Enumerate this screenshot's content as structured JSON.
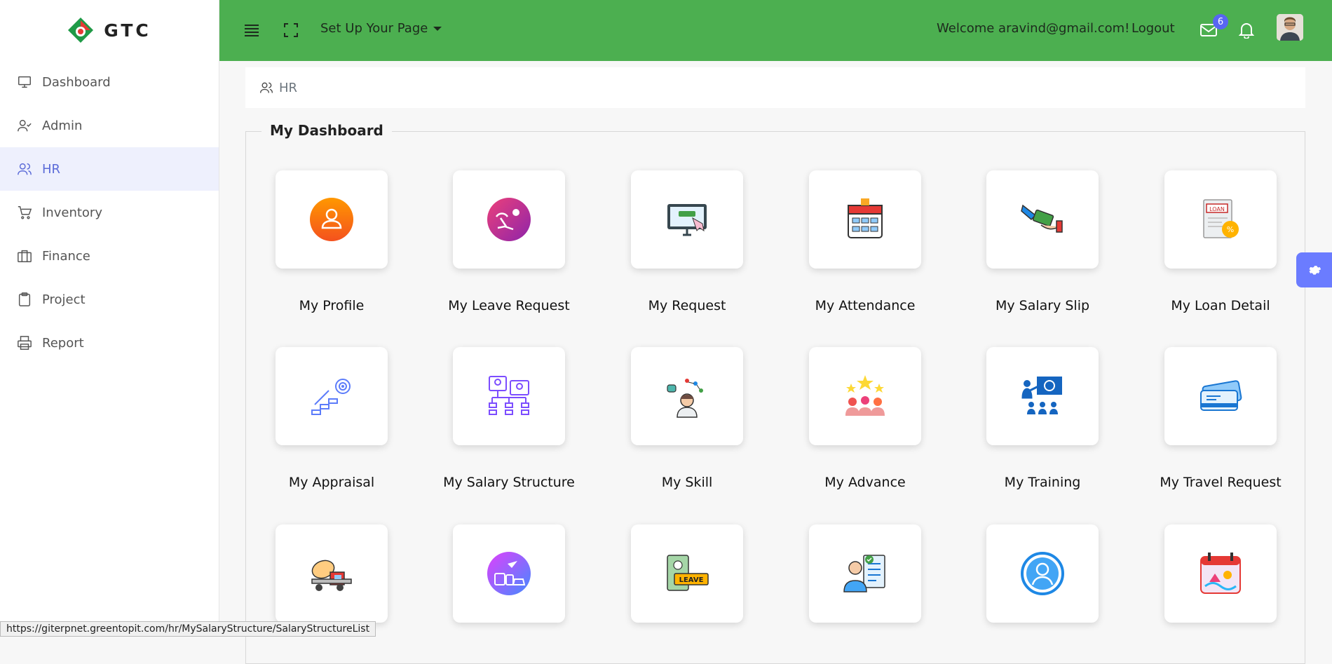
{
  "brand": {
    "name": "GTC"
  },
  "sidebar": {
    "items": [
      {
        "label": "Dashboard",
        "icon": "monitor-icon"
      },
      {
        "label": "Admin",
        "icon": "user-check-icon"
      },
      {
        "label": "HR",
        "icon": "users-icon",
        "active": true
      },
      {
        "label": "Inventory",
        "icon": "cart-icon"
      },
      {
        "label": "Finance",
        "icon": "briefcase-icon"
      },
      {
        "label": "Project",
        "icon": "clipboard-icon"
      },
      {
        "label": "Report",
        "icon": "printer-icon"
      }
    ]
  },
  "header": {
    "setup_label": "Set Up Your Page",
    "welcome": "Welcome aravind@gmail.com!",
    "logout": "Logout",
    "mail_count": "6",
    "accent": "#4caf50"
  },
  "breadcrumb": {
    "label": "HR"
  },
  "dashboard": {
    "title": "My Dashboard",
    "tiles": [
      {
        "label": "My Profile",
        "icon": "profile-icon"
      },
      {
        "label": "My Leave Request",
        "icon": "beach-leave-icon"
      },
      {
        "label": "My Request",
        "icon": "computer-request-icon"
      },
      {
        "label": "My Attendance",
        "icon": "attendance-calendar-icon"
      },
      {
        "label": "My Salary Slip",
        "icon": "cash-hand-icon"
      },
      {
        "label": "My Loan Detail",
        "icon": "loan-document-icon"
      },
      {
        "label": "My Appraisal",
        "icon": "growth-target-icon"
      },
      {
        "label": "My Salary Structure",
        "icon": "org-structure-icon"
      },
      {
        "label": "My Skill",
        "icon": "skill-person-icon"
      },
      {
        "label": "My Advance",
        "icon": "stars-team-icon"
      },
      {
        "label": "My Training",
        "icon": "training-board-icon"
      },
      {
        "label": "My Travel Request",
        "icon": "travel-ticket-icon"
      },
      {
        "label": "",
        "icon": "truck-icon"
      },
      {
        "label": "",
        "icon": "travel-circle-icon"
      },
      {
        "label": "",
        "icon": "leave-card-icon"
      },
      {
        "label": "",
        "icon": "checklist-person-icon"
      },
      {
        "label": "",
        "icon": "user-circle-icon"
      },
      {
        "label": "",
        "icon": "calendar-sun-icon"
      }
    ]
  },
  "status_bar": {
    "url": "https://giterpnet.greentopit.com/hr/MySalaryStructure/SalaryStructureList"
  }
}
